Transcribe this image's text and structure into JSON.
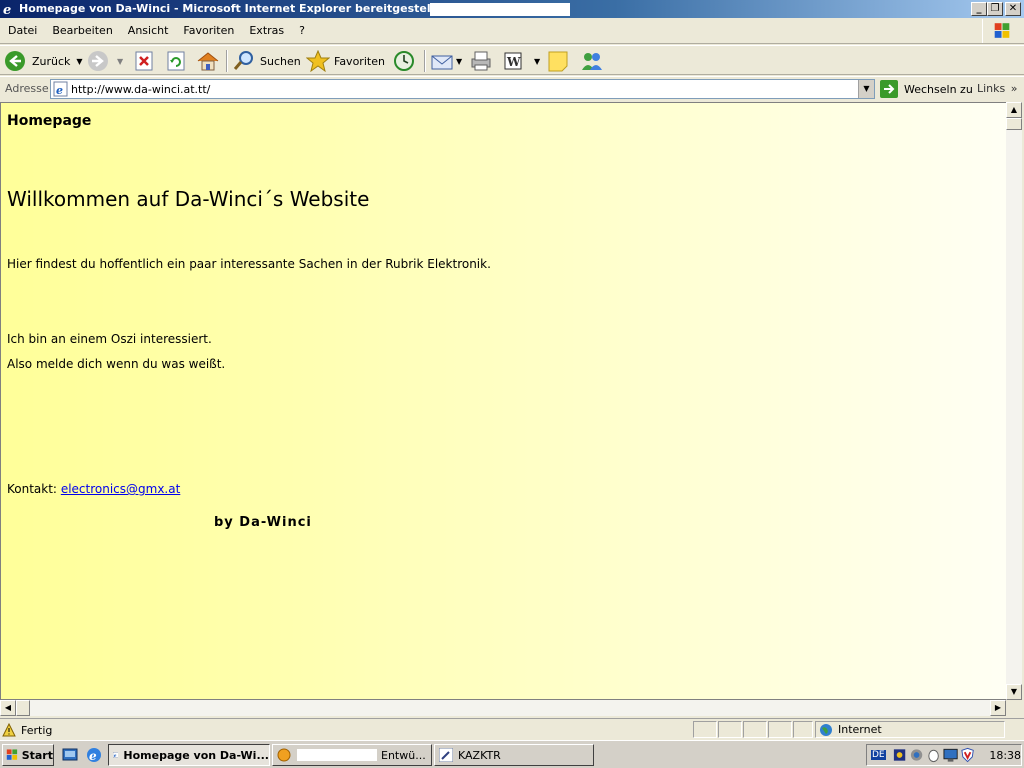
{
  "window": {
    "title": "Homepage von Da-Winci - Microsoft Internet Explorer bereitgestellt von"
  },
  "menu": [
    {
      "label": "Datei"
    },
    {
      "label": "Bearbeiten"
    },
    {
      "label": "Ansicht"
    },
    {
      "label": "Favoriten"
    },
    {
      "label": "Extras"
    },
    {
      "label": "?"
    }
  ],
  "toolbar": {
    "back": "Zurück",
    "search": "Suchen",
    "favorites": "Favoriten"
  },
  "address": {
    "label": "Adresse",
    "url": "http://www.da-winci.at.tt/",
    "go": "Wechseln zu",
    "links": "Links"
  },
  "page": {
    "heading_small": "Homepage",
    "heading": "Willkommen auf Da-Winci´s Website",
    "intro": "Hier findest du hoffentlich ein paar interessante Sachen in der Rubrik Elektronik.",
    "line1": "Ich bin an einem Oszi interessiert.",
    "line2": "Also melde dich wenn du was weißt.",
    "contact_label": "Kontakt:",
    "contact_email": "electronics@gmx.at",
    "signature": "by Da-Winci"
  },
  "status": {
    "text": "Fertig",
    "zone": "Internet"
  },
  "taskbar": {
    "start": "Start",
    "tasks": [
      {
        "label": "Homepage von Da-Wi..."
      },
      {
        "label": "Entwü..."
      },
      {
        "label": "KAZKTR"
      }
    ],
    "lang": "DE",
    "clock": "18:38"
  }
}
